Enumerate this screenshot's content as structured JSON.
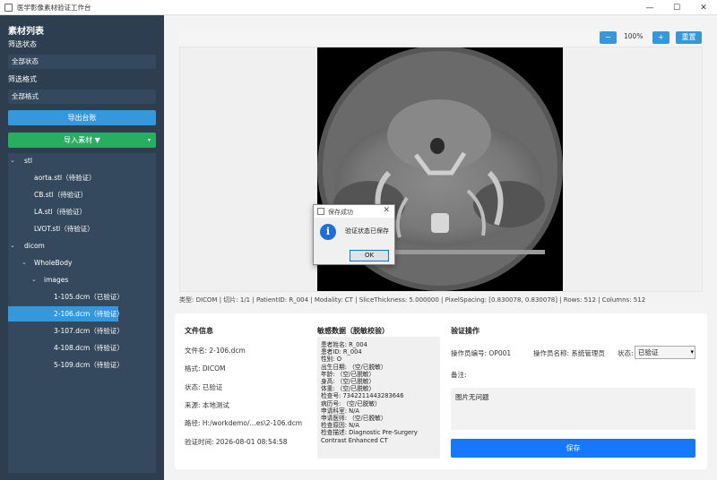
{
  "window": {
    "title": "医学影像素材验证工作台",
    "minimize": "—",
    "maximize": "☐",
    "close": "✕"
  },
  "sidebar": {
    "title": "素材列表",
    "status_filter_label": "筛选状态",
    "status_filter_value": "全部状态",
    "format_filter_label": "筛选格式",
    "format_filter_value": "全部格式",
    "export_label": "导出台账",
    "import_label": "导入素材 ▼",
    "import_arrow": "▾",
    "tree": [
      {
        "label": "stl",
        "chevron": "⌄"
      },
      {
        "label": "aorta.stl（待验证）"
      },
      {
        "label": "CB.stl（待验证）"
      },
      {
        "label": "LA.stl（待验证）"
      },
      {
        "label": "LVOT.stl（待验证）"
      },
      {
        "label": "dicom",
        "chevron": "⌄"
      },
      {
        "label": "WholeBody",
        "chevron": "⌄"
      },
      {
        "label": "images",
        "chevron": "⌄"
      },
      {
        "label": "1-105.dcm（已验证）"
      },
      {
        "label": "2-106.dcm（待验证）"
      },
      {
        "label": "3-107.dcm（待验证）"
      },
      {
        "label": "4-108.dcm（待验证）"
      },
      {
        "label": "5-109.dcm（待验证）"
      }
    ]
  },
  "toolbar": {
    "zoom_out": "−",
    "zoom_value": "100%",
    "zoom_in": "+",
    "reset": "重置"
  },
  "viewer": {
    "info": "类型: DICOM | 切片: 1/1 | PatientID: R_004 | Modality: CT | SliceThickness: 5.000000 | PixelSpacing: [0.830078, 0.830078] | Rows: 512 | Columns: 512"
  },
  "file_info": {
    "title": "文件信息",
    "name": "文件名: 2-106.dcm",
    "format": "格式: DICOM",
    "status": "状态: 已验证",
    "source": "来源: 本地测试",
    "path": "路径: H:/workdemo/...es\\2-106.dcm",
    "verified_time": "验证时间: 2026-08-01 08:54:58"
  },
  "sensitive": {
    "title": "敏感数据（脱敏校验）",
    "lines": [
      "患者姓名: R_004",
      "患者ID: R_004",
      "性别: O",
      "出生日期: （空/已脱敏）",
      "年龄: （空/已脱敏）",
      "身高: （空/已脱敏）",
      "体重: （空/已脱敏）",
      "检查号: 7342211443283646",
      "病历号: （空/已脱敏）",
      "申请科室: N/A",
      "申请医师: （空/已脱敏）",
      "检查原因: N/A",
      "检查描述: Diagnostic Pre-Surgery Contrast Enhanced CT"
    ]
  },
  "verify": {
    "title": "验证操作",
    "operator_id": "操作员编号: OP001",
    "operator_name": "操作员名称: 系统管理员",
    "status_label": "状态:",
    "status_value": "已验证",
    "status_arrow": "▾",
    "remark_label": "备注:",
    "remark_value": "图片无问题",
    "save_label": "保存"
  },
  "dialog": {
    "title": "保存成功",
    "close": "✕",
    "icon": "i",
    "message": "验证状态已保存",
    "ok": "OK"
  }
}
